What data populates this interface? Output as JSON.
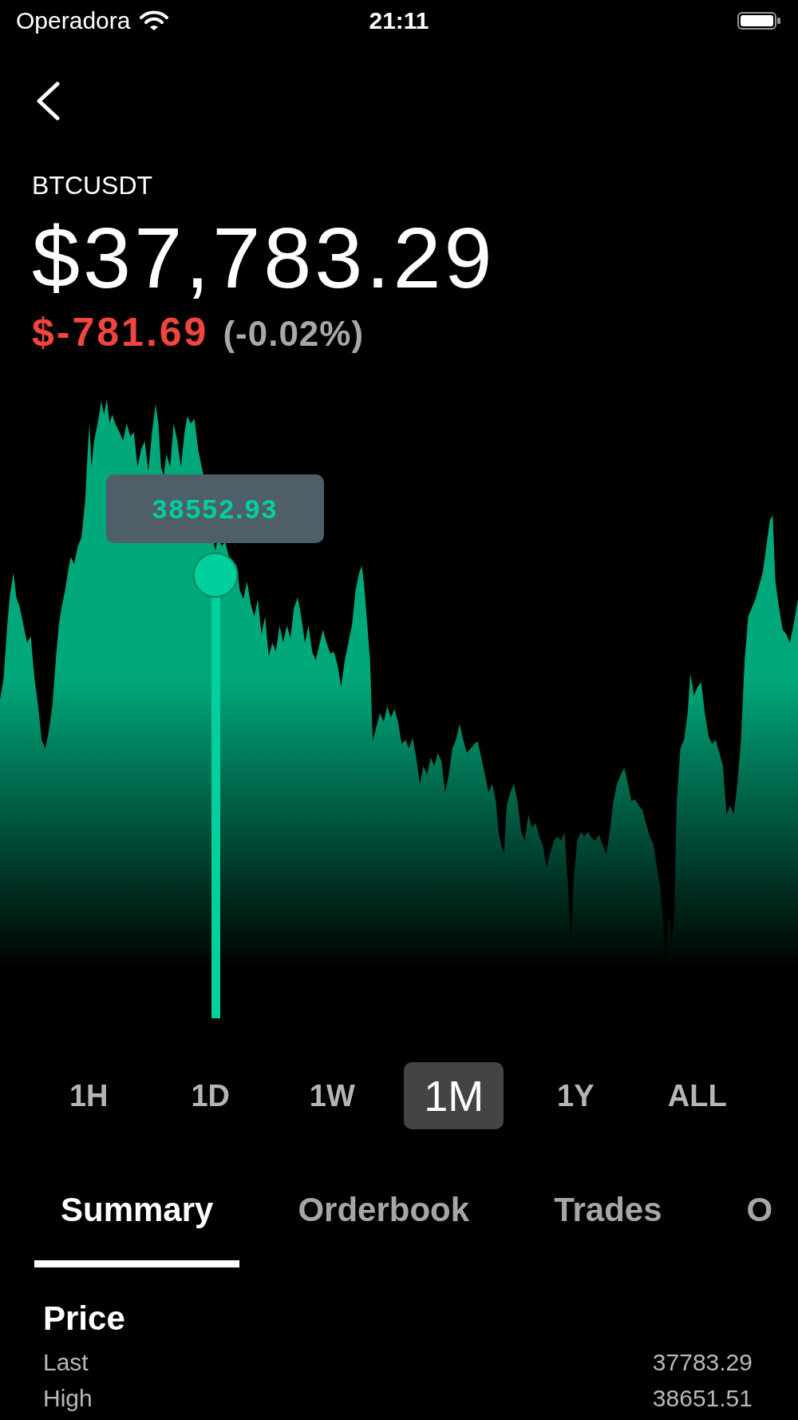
{
  "status_bar": {
    "carrier": "Operadora",
    "time": "21:11"
  },
  "header": {
    "symbol": "BTCUSDT",
    "price": "$37,783.29",
    "change": {
      "amount": "$-781.69",
      "percent": "(-0.02%)",
      "negative": true
    }
  },
  "chart": {
    "tooltip": "38552.93"
  },
  "ranges": [
    {
      "label": "1H",
      "selected": false
    },
    {
      "label": "1D",
      "selected": false
    },
    {
      "label": "1W",
      "selected": false
    },
    {
      "label": "1M",
      "selected": true
    },
    {
      "label": "1Y",
      "selected": false
    },
    {
      "label": "ALL",
      "selected": false
    }
  ],
  "tabs": [
    {
      "label": "Summary",
      "selected": true
    },
    {
      "label": "Orderbook",
      "selected": false
    },
    {
      "label": "Trades",
      "selected": false
    },
    {
      "label": "O",
      "selected": false
    }
  ],
  "summary": {
    "section_title": "Price",
    "rows": [
      {
        "label": "Last",
        "value": "37783.29"
      },
      {
        "label": "High",
        "value": "38651.51"
      }
    ]
  }
}
